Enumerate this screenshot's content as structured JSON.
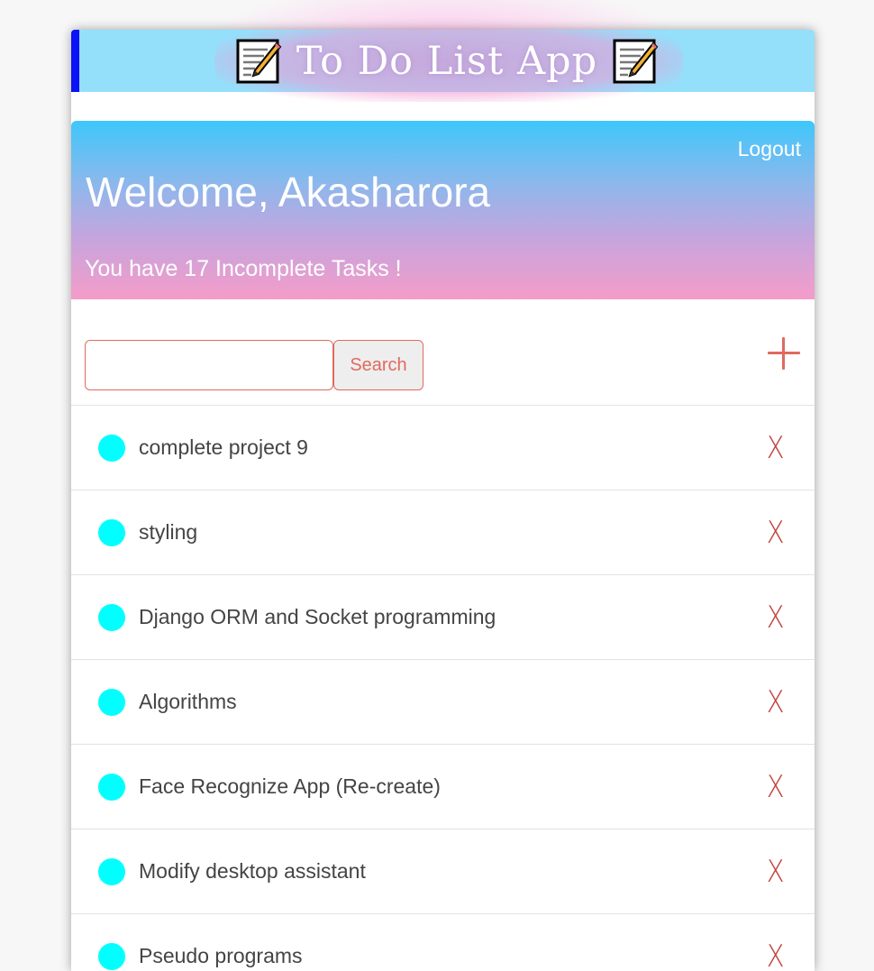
{
  "app": {
    "title": "To Do List App"
  },
  "hero": {
    "logout_label": "Logout",
    "welcome": "Welcome, Akasharora",
    "incomplete_message": "You have 17 Incomplete Tasks !"
  },
  "search": {
    "value": "",
    "placeholder": "",
    "button_label": "Search"
  },
  "tasks": [
    {
      "title": "complete project 9",
      "delete": "X"
    },
    {
      "title": "styling",
      "delete": "X"
    },
    {
      "title": "Django ORM and Socket programming",
      "delete": "X"
    },
    {
      "title": "Algorithms",
      "delete": "X"
    },
    {
      "title": "Face Recognize App (Re-create)",
      "delete": "X"
    },
    {
      "title": "Modify desktop assistant",
      "delete": "X"
    },
    {
      "title": "Pseudo programs",
      "delete": "X"
    }
  ],
  "colors": {
    "accent": "#e06a5f",
    "delete": "#c0413b",
    "task_dot": "#00ffff",
    "title_bar": "#94e0fb",
    "title_bar_border": "#0b12f5"
  },
  "icons": {
    "title_left": "memo-icon",
    "title_right": "memo-icon",
    "add": "plus-icon"
  }
}
